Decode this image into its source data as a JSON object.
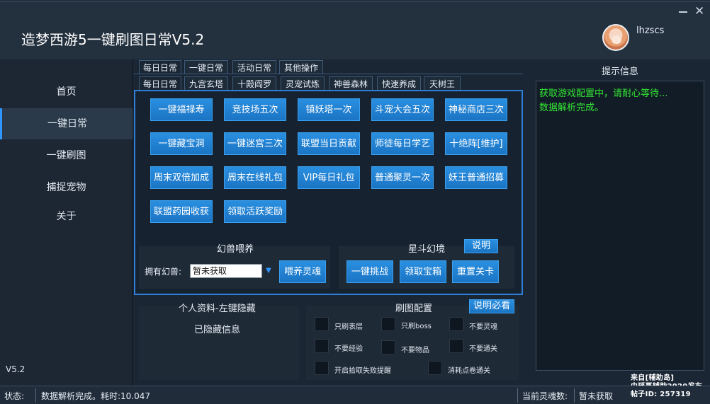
{
  "window": {
    "title": "造梦西游5一键刷图日常V5.2",
    "username": "lhzscs"
  },
  "sidebar": {
    "items": [
      {
        "label": "首页"
      },
      {
        "label": "一键日常"
      },
      {
        "label": "一键刷图"
      },
      {
        "label": "捕捉宠物"
      },
      {
        "label": "关于"
      }
    ],
    "version": "V5.2"
  },
  "tabs_top": [
    "每日日常",
    "一键日常",
    "活动日常",
    "其他操作"
  ],
  "tabs_sub": [
    "每日日常",
    "九宫玄塔",
    "十殿阎罗",
    "灵宠试炼",
    "神兽森林",
    "快速养成",
    "天树王"
  ],
  "buttons": [
    "一键福禄寿",
    "竞技场五次",
    "镇妖塔一次",
    "斗宠大会五次",
    "神秘商店三次",
    "一键藏宝洞",
    "一键迷宫三次",
    "联盟当日贡献",
    "师徒每日学艺",
    "十绝阵[维护]",
    "周末双倍加成",
    "周末在线礼包",
    "VIP每日礼包",
    "普通聚灵一次",
    "妖王普通招募",
    "联盟药园收获",
    "领取活跃奖励"
  ],
  "pet_feed": {
    "title": "幻兽喂养",
    "owned_label": "拥有幻兽:",
    "owned_value": "暂未获取",
    "feed_button": "喂养灵魂"
  },
  "star_dream": {
    "title": "星斗幻境",
    "help_button": "说明",
    "buttons": [
      "一键挑战",
      "领取宝箱",
      "重置关卡"
    ]
  },
  "profile": {
    "title": "个人资料-左键隐藏",
    "hidden_text": "已隐藏信息"
  },
  "map_config": {
    "title": "刷图配置",
    "help_button": "说明必看",
    "options": [
      "只刷表层",
      "只刷boss",
      "不要灵魂",
      "不要经验",
      "不要物品",
      "不要通关",
      "开启拾取失败提醒",
      "消耗点卷通关"
    ]
  },
  "info": {
    "title": "提示信息",
    "lines": [
      "获取游戏配置中，请耐心等待...",
      "数据解析完成。"
    ]
  },
  "status": {
    "label": "状态:",
    "message": "数据解析完成。耗时:10.047",
    "soul_label": "当前灵魂数:",
    "soul_value": "暂未获取"
  },
  "watermark": [
    "来自[辅助岛]",
    "由瑶哥辅助2020发布",
    "帖子ID: 257319"
  ],
  "colors": {
    "accent": "#2f95ff",
    "button": "#1f80d0",
    "info_text": "#33e633",
    "background": "#1a2634"
  }
}
